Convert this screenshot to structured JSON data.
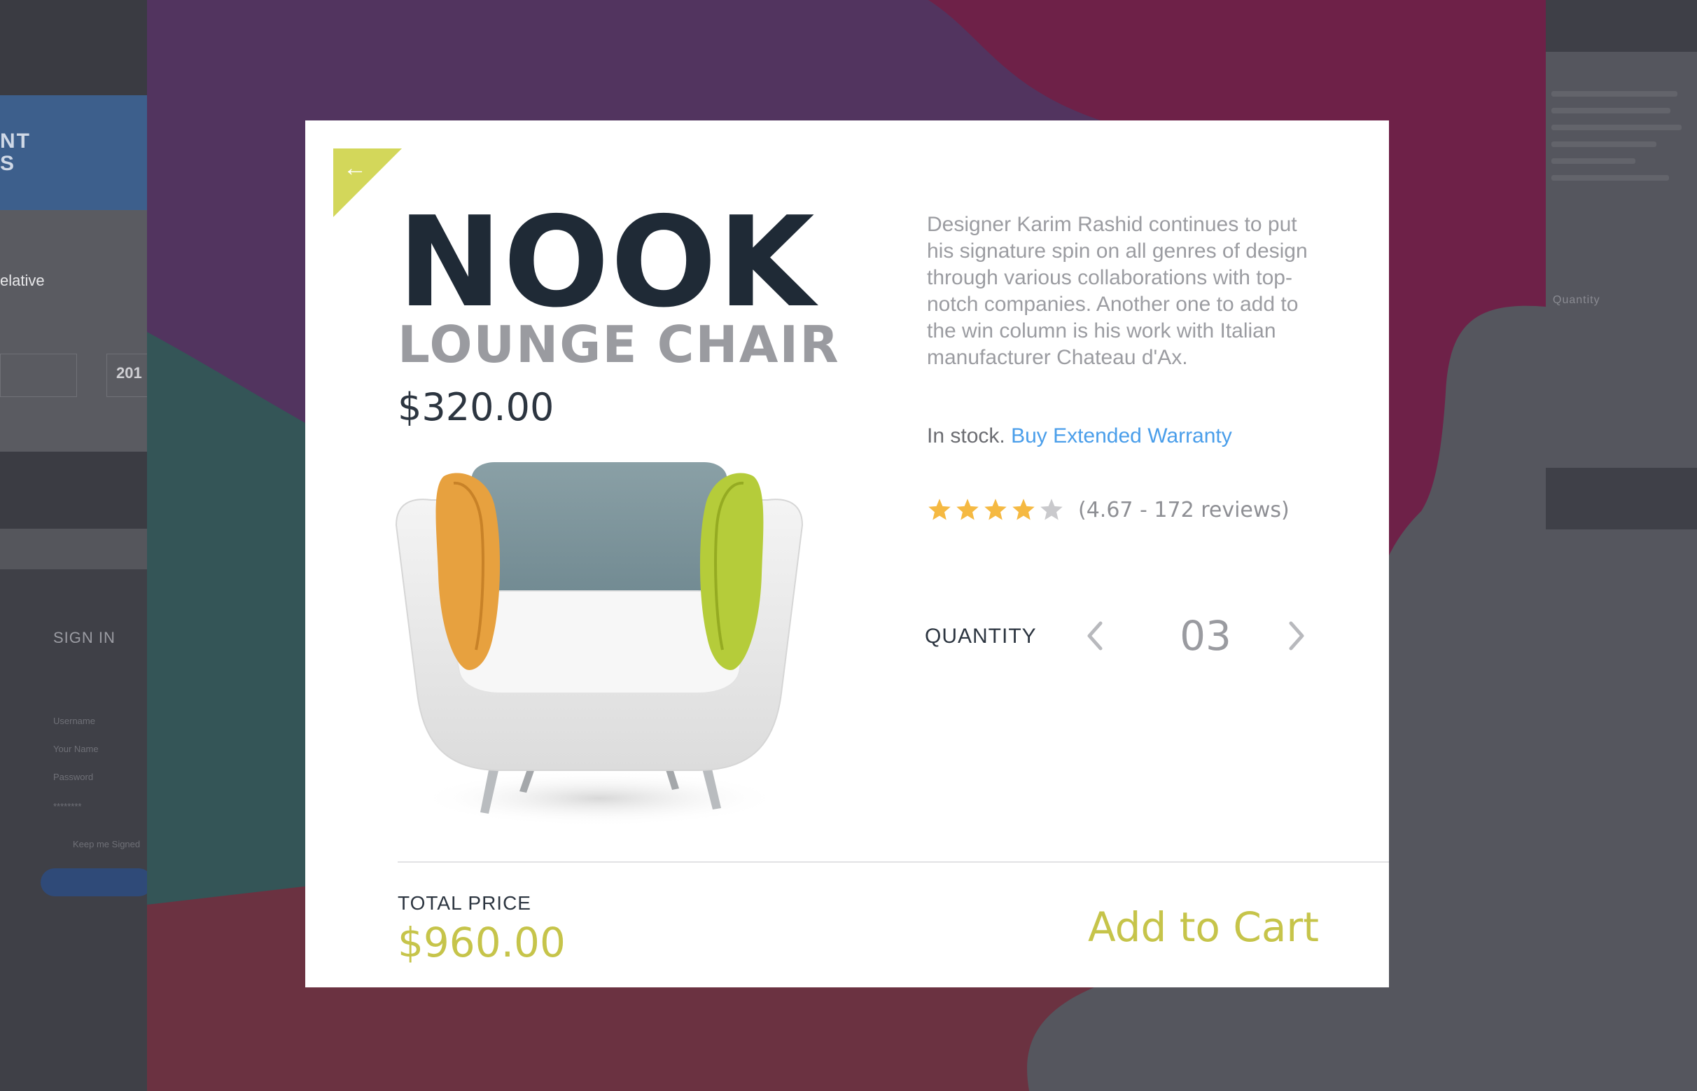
{
  "background_app": {
    "left": {
      "header_text": "NT\nS",
      "field_value": "elative",
      "select_value": "201",
      "sign_in": "SIGN IN",
      "small_1": "Username",
      "small_2": "Your Name",
      "small_3": "Password",
      "small_4": "********",
      "remember": "Keep me Signed"
    },
    "right": {
      "quantity_label": "Quantity"
    }
  },
  "product_modal": {
    "back_icon": "arrow-left-icon",
    "title": "NOOK",
    "subtitle": "LOUNGE CHAIR",
    "price": "$320.00",
    "description": "Designer Karim Rashid continues to put his signature spin on all genres of design through various collaborations with top-notch companies. Another one to add to the win column is his work with Italian manufacturer Chateau d'Ax.",
    "stock_text": "In stock.",
    "warranty_link": "Buy Extended Warranty",
    "rating": {
      "value": 4.67,
      "max": 5,
      "filled_stars": 4,
      "text": "(4.67 - 172 reviews)"
    },
    "quantity": {
      "label": "QUANTITY",
      "value": "03"
    },
    "total": {
      "label": "TOTAL PRICE",
      "value": "$960.00"
    },
    "add_to_cart": "Add to Cart",
    "colors": {
      "accent": "#c6c44a",
      "flag": "#d3d75a",
      "link": "#4a9eea",
      "star": "#f5b942",
      "star_empty": "#c9c9cc",
      "title": "#1f2a36"
    }
  }
}
